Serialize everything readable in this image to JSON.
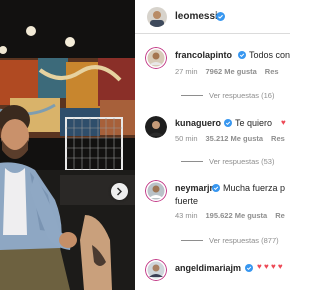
{
  "post": {
    "author": "leomessi"
  },
  "comments": [
    {
      "username": "francolapinto",
      "text": "Todos con",
      "time": "27 min",
      "likes": "7962 Me gusta",
      "action": "Res",
      "replies": "Ver respuestas (16)"
    },
    {
      "username": "kunaguero",
      "text": "Te quiero",
      "time": "50 min",
      "likes": "35.212 Me gusta",
      "action": "Res",
      "replies": "Ver respuestas (53)"
    },
    {
      "username": "neymarjr",
      "text": "Mucha fuerza p",
      "text_line2": "fuerte",
      "time": "43 min",
      "likes": "195.622 Me gusta",
      "action": "Re",
      "replies": "Ver respuestas (877)"
    },
    {
      "username": "angeldimariajm",
      "hearts": "♥ ♥ ♥ ♥"
    }
  ],
  "colors": {
    "verified": "#3897f0",
    "heart": "#ed4956",
    "muted": "#8e8e8e",
    "text": "#262626"
  },
  "icons": {
    "verified": "verified-badge-icon",
    "heart": "heart-icon",
    "next": "chevron-right-icon"
  }
}
